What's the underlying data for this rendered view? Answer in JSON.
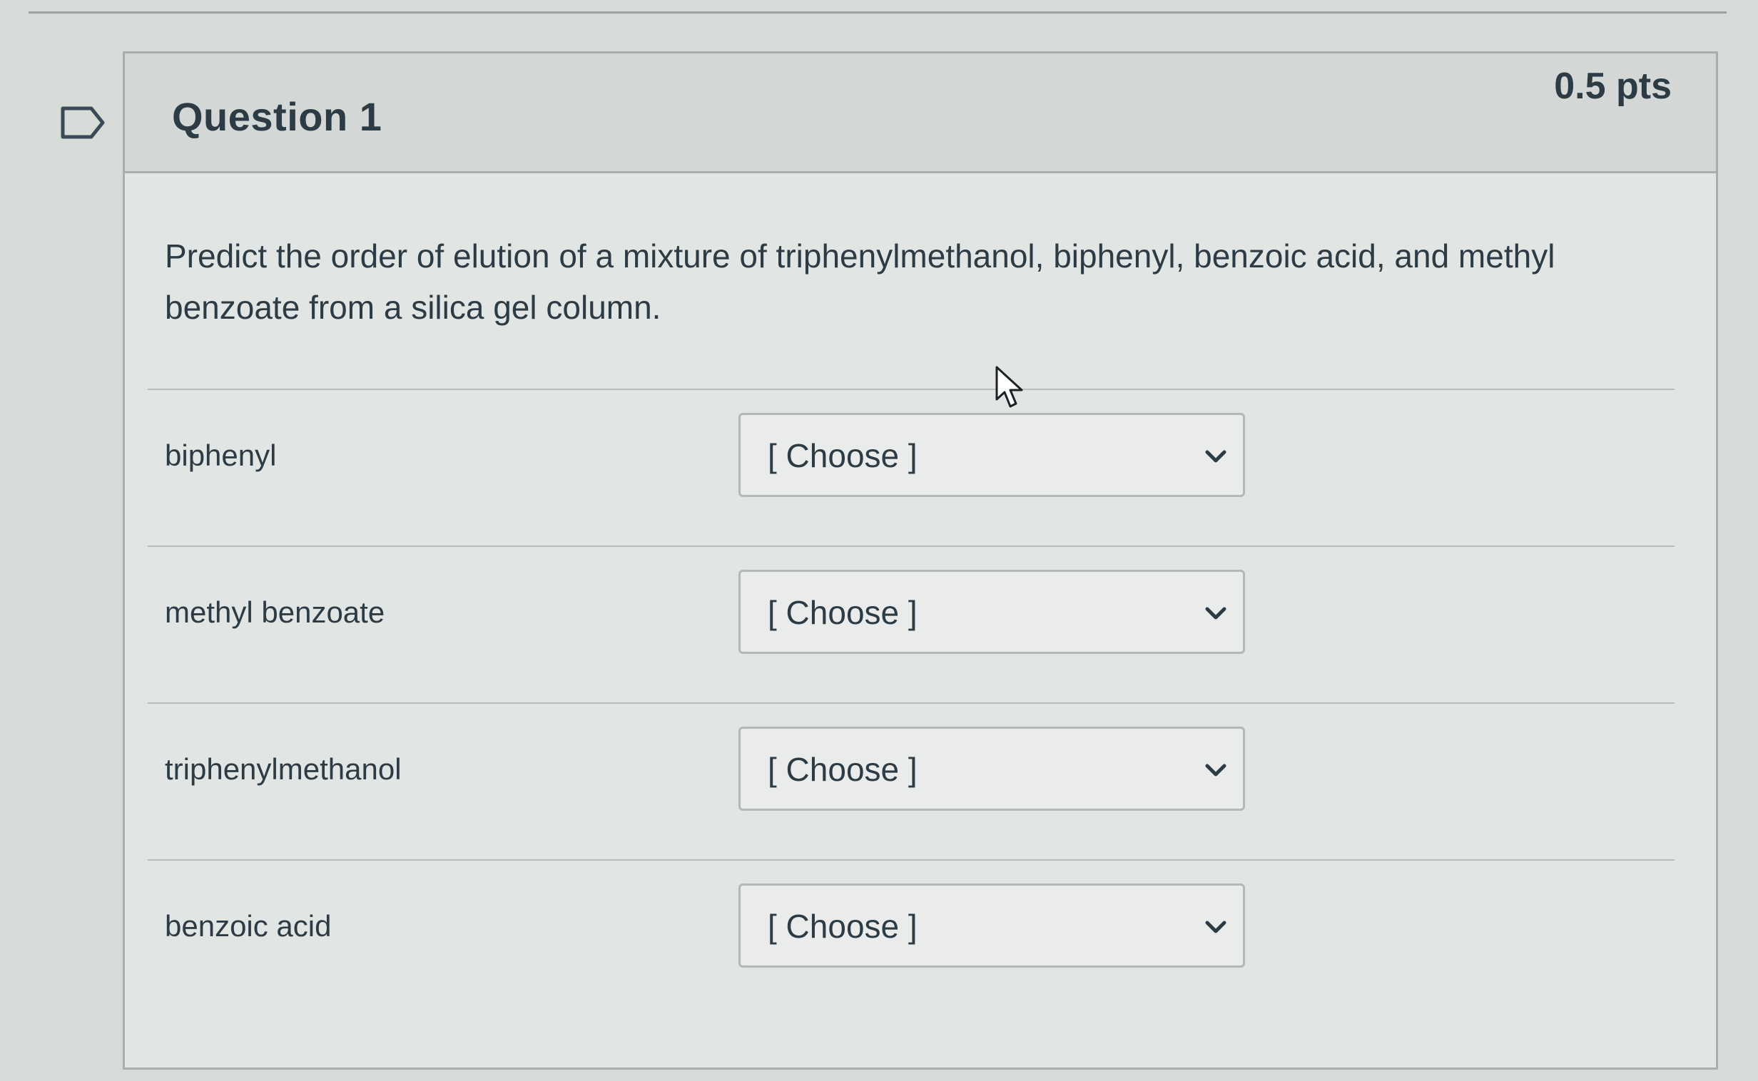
{
  "question": {
    "title": "Question 1",
    "points": "0.5 pts",
    "prompt": "Predict the order of elution of a mixture of triphenylmethanol, biphenyl, benzoic acid, and methyl benzoate from a silica gel column."
  },
  "rows": [
    {
      "label": "biphenyl",
      "selected": "[ Choose ]"
    },
    {
      "label": "methyl benzoate",
      "selected": "[ Choose ]"
    },
    {
      "label": "triphenylmethanol",
      "selected": "[ Choose ]"
    },
    {
      "label": "benzoic acid",
      "selected": "[ Choose ]"
    }
  ],
  "icons": {
    "flag": "flag-icon",
    "dropdown": "chevron-down-icon",
    "cursor": "mouse-pointer-icon"
  }
}
